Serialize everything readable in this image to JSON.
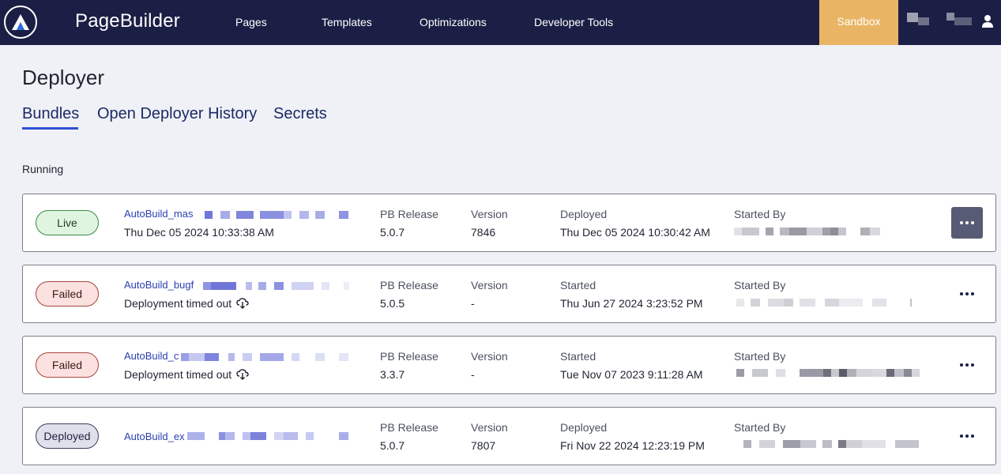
{
  "header": {
    "app_name": "PageBuilder",
    "nav": [
      "Pages",
      "Templates",
      "Optimizations",
      "Developer Tools"
    ],
    "environment": "Sandbox"
  },
  "page": {
    "title": "Deployer",
    "tabs": [
      "Bundles",
      "Open Deployer History",
      "Secrets"
    ],
    "active_tab": "Bundles",
    "section": "Running"
  },
  "bundles": [
    {
      "status": "Live",
      "name": "AutoBuild_mas",
      "subtitle": "Thu Dec 05 2024 10:33:38 AM",
      "release_label": "PB Release",
      "release": "5.0.7",
      "version_label": "Version",
      "version": "7846",
      "time_label": "Deployed",
      "time": "Thu Dec 05 2024 10:30:42 AM",
      "started_by_label": "Started By"
    },
    {
      "status": "Failed",
      "name": "AutoBuild_bugf",
      "subtitle": "Deployment timed out",
      "release_label": "PB Release",
      "release": "5.0.5",
      "version_label": "Version",
      "version": "-",
      "time_label": "Started",
      "time": "Thu Jun 27 2024 3:23:52 PM",
      "started_by_label": "Started By"
    },
    {
      "status": "Failed",
      "name": "AutoBuild_c",
      "subtitle": "Deployment timed out",
      "release_label": "PB Release",
      "release": "3.3.7",
      "version_label": "Version",
      "version": "-",
      "time_label": "Started",
      "time": "Tue Nov 07 2023 9:11:28 AM",
      "started_by_label": "Started By"
    },
    {
      "status": "Deployed",
      "name": "AutoBuild_ex",
      "subtitle": "",
      "release_label": "PB Release",
      "release": "5.0.7",
      "version_label": "Version",
      "version": "7807",
      "time_label": "Deployed",
      "time": "Fri Nov 22 2024 12:23:19 PM",
      "started_by_label": "Started By"
    }
  ],
  "colors": {
    "nav_bg": "#1b1f45",
    "sandbox": "#e9b565",
    "link": "#2a3fb0",
    "tab_underline": "#2f4fd6",
    "live_bg": "#dff5df",
    "failed_bg": "#fbe1df",
    "deployed_bg": "#dfe0ec"
  }
}
